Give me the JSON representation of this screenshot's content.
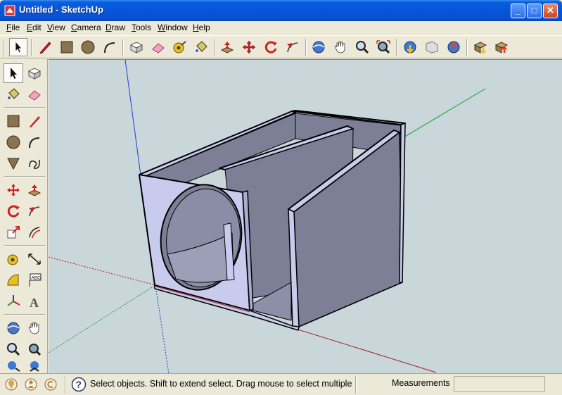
{
  "window": {
    "title": "Untitled - SketchUp",
    "min_label": "_",
    "max_label": "□",
    "close_label": "✕"
  },
  "menu": [
    {
      "label": "File",
      "u": "F",
      "rest": "ile"
    },
    {
      "label": "Edit",
      "u": "E",
      "rest": "dit"
    },
    {
      "label": "View",
      "u": "V",
      "rest": "iew"
    },
    {
      "label": "Camera",
      "u": "C",
      "rest": "amera"
    },
    {
      "label": "Draw",
      "u": "D",
      "rest": "raw"
    },
    {
      "label": "Tools",
      "u": "T",
      "rest": "ools"
    },
    {
      "label": "Window",
      "u": "W",
      "rest": "indow"
    },
    {
      "label": "Help",
      "u": "H",
      "rest": "elp"
    }
  ],
  "toolbar_top": [
    "select-icon",
    "line-icon",
    "rectangle-icon",
    "circle-icon",
    "arc-icon",
    "make-component-icon",
    "eraser-icon",
    "tape-measure-icon",
    "paint-bucket-icon",
    "push-pull-icon",
    "move-icon",
    "rotate-icon",
    "follow-me-icon",
    "orbit-icon",
    "pan-icon",
    "zoom-icon",
    "zoom-extents-icon",
    "get-models-icon",
    "share-model-icon",
    "place-model-icon",
    "get-component-icon",
    "share-component-icon"
  ],
  "status": {
    "text": "Select objects. Shift to extend select. Drag mouse to select multiple.",
    "measurements_label": "Measurements",
    "measurements_value": ""
  },
  "colors": {
    "accent": "#0a5ee0",
    "viewport_bg": "#c9d6da",
    "face_front": "#c9cbee",
    "face_side": "#7c7f96",
    "edge": "#000000"
  }
}
